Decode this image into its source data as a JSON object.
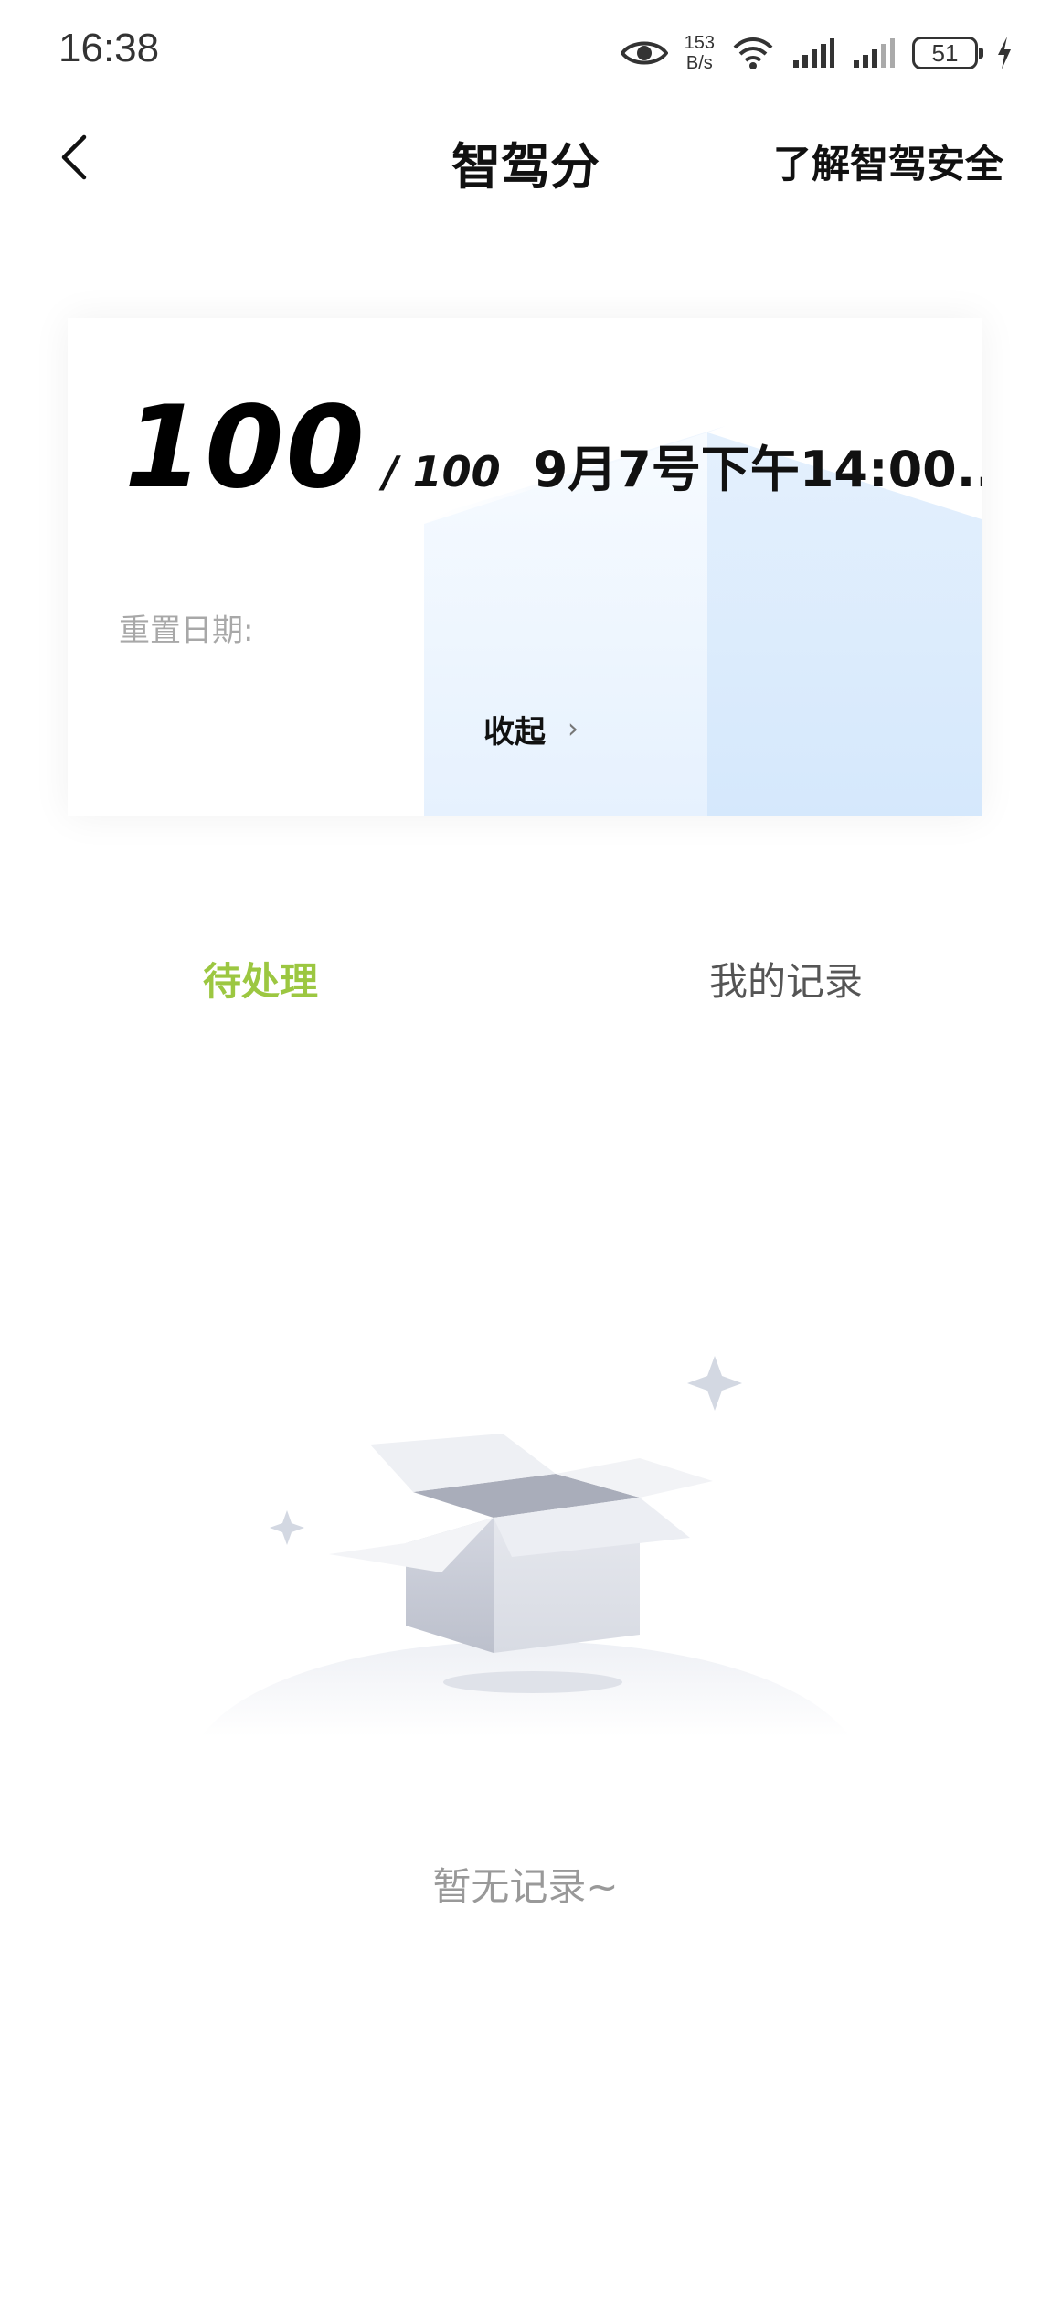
{
  "status_bar": {
    "time": "16:38",
    "net_speed_value": "153",
    "net_speed_unit": "B/s",
    "battery": "51",
    "icons": [
      "eye-icon",
      "wifi-icon",
      "signal-icon",
      "signal-icon",
      "battery-icon",
      "charging-icon"
    ]
  },
  "header": {
    "title": "智驾分",
    "right_link": "了解智驾安全"
  },
  "score_card": {
    "score": "100",
    "total": "/ 100",
    "date": "9月7号下午14:00...",
    "reset_label": "重置日期:",
    "collapse_label": "收起",
    "collapse_chevron": "›"
  },
  "tabs": [
    {
      "label": "待处理",
      "active": true
    },
    {
      "label": "我的记录",
      "active": false
    }
  ],
  "empty_state": {
    "text": "暂无记录~"
  },
  "colors": {
    "accent": "#9cc741",
    "muted_text": "#999999"
  }
}
